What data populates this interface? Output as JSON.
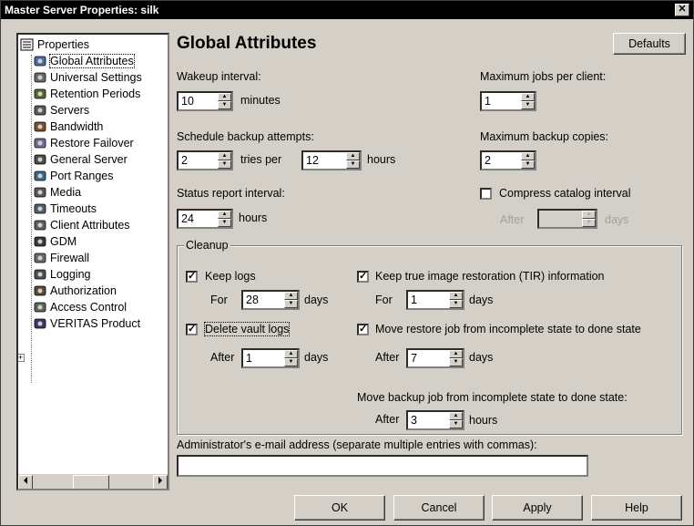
{
  "window": {
    "title": "Master Server Properties: silk",
    "close_glyph": "✕"
  },
  "tree": {
    "root": "Properties",
    "items": [
      {
        "label": "Global Attributes",
        "icon": "globe-icon"
      },
      {
        "label": "Universal Settings",
        "icon": "settings-icon"
      },
      {
        "label": "Retention Periods",
        "icon": "clock-icon"
      },
      {
        "label": "Servers",
        "icon": "server-icon"
      },
      {
        "label": "Bandwidth",
        "icon": "bandwidth-icon"
      },
      {
        "label": "Restore Failover",
        "icon": "failover-icon"
      },
      {
        "label": "General Server",
        "icon": "server-icon"
      },
      {
        "label": "Port Ranges",
        "icon": "port-icon"
      },
      {
        "label": "Media",
        "icon": "media-icon"
      },
      {
        "label": "Timeouts",
        "icon": "timer-icon"
      },
      {
        "label": "Client Attributes",
        "icon": "client-icon"
      },
      {
        "label": "GDM",
        "icon": "gdm-icon"
      },
      {
        "label": "Firewall",
        "icon": "firewall-icon"
      },
      {
        "label": "Logging",
        "icon": "log-icon"
      },
      {
        "label": "Authorization",
        "icon": "user-icon"
      },
      {
        "label": "Access Control",
        "icon": "access-icon"
      },
      {
        "label": "VERITAS Product",
        "icon": "veritas-icon"
      }
    ],
    "expand_glyph": "+"
  },
  "main": {
    "heading": "Global Attributes",
    "defaults_button": "Defaults",
    "wakeup_label": "Wakeup interval:",
    "wakeup_value": "10",
    "wakeup_unit": "minutes",
    "schedule_label": "Schedule backup attempts:",
    "schedule_tries_value": "2",
    "schedule_tries_unit": "tries per",
    "schedule_hours_value": "12",
    "schedule_hours_unit": "hours",
    "status_label": "Status report interval:",
    "status_value": "24",
    "status_unit": "hours",
    "max_jobs_label": "Maximum jobs per client:",
    "max_jobs_value": "1",
    "max_copies_label": "Maximum backup copies:",
    "max_copies_value": "2",
    "compress_label": "Compress catalog interval",
    "compress_checked": false,
    "compress_after_label": "After",
    "compress_after_unit": "days",
    "cleanup": {
      "title": "Cleanup",
      "keep_logs_label": "Keep logs",
      "keep_logs_checked": true,
      "keep_logs_for": "For",
      "keep_logs_value": "28",
      "keep_logs_unit": "days",
      "delete_vault_label": "Delete vault logs",
      "delete_vault_checked": true,
      "delete_vault_after": "After",
      "delete_vault_value": "1",
      "delete_vault_unit": "days",
      "tir_label": "Keep true image restoration (TIR) information",
      "tir_checked": true,
      "tir_for": "For",
      "tir_value": "1",
      "tir_unit": "days",
      "move_restore_label": "Move restore job from incomplete state to done state",
      "move_restore_checked": true,
      "move_restore_after": "After",
      "move_restore_value": "7",
      "move_restore_unit": "days",
      "move_backup_label": "Move backup job from incomplete state to done state:",
      "move_backup_after": "After",
      "move_backup_value": "3",
      "move_backup_unit": "hours"
    },
    "email_label": "Administrator's e-mail address (separate multiple entries with commas):",
    "email_value": ""
  },
  "buttons": {
    "ok": "OK",
    "cancel": "Cancel",
    "apply": "Apply",
    "help": "Help"
  },
  "check_glyph": "✓"
}
